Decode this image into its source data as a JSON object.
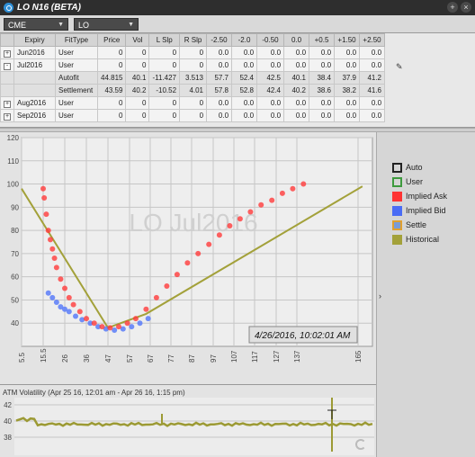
{
  "window": {
    "title": "LO N16 (BETA)",
    "buttons": [
      "+",
      "×"
    ]
  },
  "toolbar": {
    "exchange": "CME",
    "product": "LO"
  },
  "table": {
    "headers": [
      "Expiry",
      "FitType",
      "Price",
      "Vol",
      "L Slp",
      "R Slp",
      "-2.50",
      "-2.0",
      "-0.50",
      "0.0",
      "+0.5",
      "+1.50",
      "+2.50"
    ],
    "rows": [
      {
        "kind": "exp",
        "toggle": "+",
        "cells": [
          "Jun2016",
          "User",
          "0",
          "0",
          "0",
          "0",
          "0.0",
          "0.0",
          "0.0",
          "0.0",
          "0.0",
          "0.0",
          "0.0"
        ]
      },
      {
        "kind": "exp",
        "toggle": "-",
        "cells": [
          "Jul2016",
          "User",
          "0",
          "0",
          "0",
          "0",
          "0.0",
          "0.0",
          "0.0",
          "0.0",
          "0.0",
          "0.0",
          "0.0"
        ]
      },
      {
        "kind": "sub",
        "toggle": "",
        "cells": [
          "",
          "Autofit",
          "44.815",
          "40.1",
          "-11.427",
          "3.513",
          "57.7",
          "52.4",
          "42.5",
          "40.1",
          "38.4",
          "37.9",
          "41.2"
        ]
      },
      {
        "kind": "sub",
        "toggle": "",
        "cells": [
          "",
          "Settlement",
          "43.59",
          "40.2",
          "-10.52",
          "4.01",
          "57.8",
          "52.8",
          "42.4",
          "40.2",
          "38.6",
          "38.2",
          "41.6"
        ]
      },
      {
        "kind": "exp",
        "toggle": "+",
        "cells": [
          "Aug2016",
          "User",
          "0",
          "0",
          "0",
          "0",
          "0.0",
          "0.0",
          "0.0",
          "0.0",
          "0.0",
          "0.0",
          "0.0"
        ]
      },
      {
        "kind": "exp",
        "toggle": "+",
        "cells": [
          "Sep2016",
          "User",
          "0",
          "0",
          "0",
          "0",
          "0.0",
          "0.0",
          "0.0",
          "0.0",
          "0.0",
          "0.0",
          "0.0"
        ]
      }
    ]
  },
  "chart_data": {
    "type": "scatter",
    "watermark": "LO Jul2016",
    "timestamp": "4/26/2016, 10:02:01 AM",
    "x_ticks": [
      "5.5",
      "15.5",
      "26",
      "36",
      "47",
      "57",
      "67",
      "77",
      "87",
      "97",
      "107",
      "117",
      "127",
      "137",
      "165"
    ],
    "y_ticks": [
      40,
      50,
      60,
      70,
      80,
      90,
      100,
      110,
      120
    ],
    "ylim": [
      30,
      120
    ],
    "xlim": [
      5.5,
      170
    ],
    "historical": [
      [
        5.5,
        98
      ],
      [
        47,
        38
      ],
      [
        65,
        44
      ],
      [
        167,
        99
      ]
    ],
    "implied_ask": [
      [
        15.5,
        98
      ],
      [
        16,
        94
      ],
      [
        17,
        87
      ],
      [
        18,
        80
      ],
      [
        19,
        76
      ],
      [
        20,
        72
      ],
      [
        21,
        68
      ],
      [
        22,
        64
      ],
      [
        24,
        59
      ],
      [
        26,
        55
      ],
      [
        28,
        51
      ],
      [
        30,
        48
      ],
      [
        33,
        45
      ],
      [
        36,
        42
      ],
      [
        40,
        40
      ],
      [
        44,
        38.5
      ],
      [
        48,
        38
      ],
      [
        52,
        38.5
      ],
      [
        56,
        40
      ],
      [
        60,
        42
      ],
      [
        65,
        46
      ],
      [
        70,
        51
      ],
      [
        75,
        56
      ],
      [
        80,
        61
      ],
      [
        85,
        66
      ],
      [
        90,
        70
      ],
      [
        95,
        74
      ],
      [
        100,
        78
      ],
      [
        105,
        82
      ],
      [
        110,
        85
      ],
      [
        115,
        88
      ],
      [
        120,
        91
      ],
      [
        125,
        93
      ],
      [
        130,
        96
      ],
      [
        135,
        98
      ],
      [
        140,
        100
      ]
    ],
    "implied_bid": [
      [
        18,
        53
      ],
      [
        20,
        51
      ],
      [
        22,
        49
      ],
      [
        24,
        47
      ],
      [
        26,
        46
      ],
      [
        28,
        45
      ],
      [
        31,
        43
      ],
      [
        34,
        41.5
      ],
      [
        38,
        40
      ],
      [
        42,
        38.5
      ],
      [
        46,
        37.5
      ],
      [
        50,
        37
      ],
      [
        54,
        37.5
      ],
      [
        58,
        38.5
      ],
      [
        62,
        40
      ],
      [
        66,
        42
      ]
    ]
  },
  "legend": {
    "items": [
      {
        "label": "Auto",
        "swatch": "#ffffff",
        "border": "#222222"
      },
      {
        "label": "User",
        "swatch": "#ffffff",
        "border": "#3e9a3e"
      },
      {
        "label": "Implied Ask",
        "swatch": "#ff3333",
        "border": "#ff3333"
      },
      {
        "label": "Implied Bid",
        "swatch": "#4a6cf5",
        "border": "#4a6cf5"
      },
      {
        "label": "Settle",
        "swatch": "#ffffff",
        "border": "#e0a030"
      },
      {
        "label": "Historical",
        "swatch": "#a3a13a",
        "border": "#a3a13a"
      }
    ]
  },
  "atm": {
    "title": "ATM Volatility (Apr 25 16, 12:01 am - Apr 26 16, 1:15 pm)",
    "y_ticks": [
      38,
      40,
      42
    ]
  }
}
